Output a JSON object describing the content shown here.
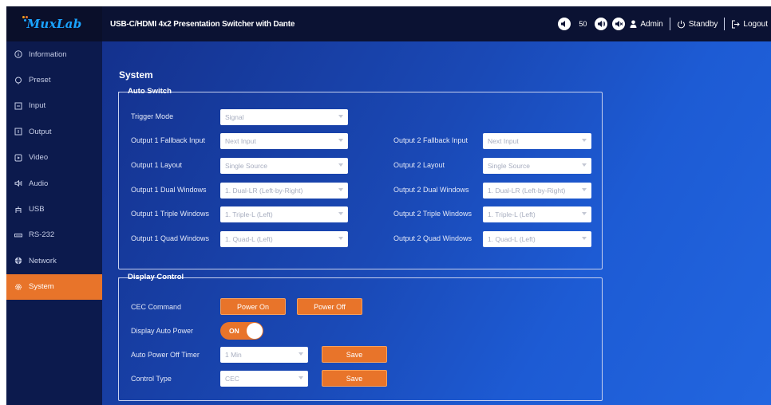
{
  "app": {
    "logo": "MuxLab",
    "title": "USB-C/HDMI 4x2 Presentation Switcher with Dante"
  },
  "topbar": {
    "volume_value": "50",
    "user_label": "Admin",
    "standby_label": "Standby",
    "logout_label": "Logout"
  },
  "sidebar": {
    "items": [
      {
        "label": "Information",
        "icon": "info-icon"
      },
      {
        "label": "Preset",
        "icon": "preset-icon"
      },
      {
        "label": "Input",
        "icon": "input-icon"
      },
      {
        "label": "Output",
        "icon": "output-icon"
      },
      {
        "label": "Video",
        "icon": "video-icon"
      },
      {
        "label": "Audio",
        "icon": "audio-icon"
      },
      {
        "label": "USB",
        "icon": "usb-icon"
      },
      {
        "label": "RS-232",
        "icon": "rs232-icon"
      },
      {
        "label": "Network",
        "icon": "network-icon"
      },
      {
        "label": "System",
        "icon": "gear-icon"
      }
    ],
    "active": "System"
  },
  "page": {
    "title": "System"
  },
  "auto_switch": {
    "legend": "Auto Switch",
    "trigger_mode": {
      "label": "Trigger Mode",
      "value": "Signal"
    },
    "out1": {
      "fallback": {
        "label": "Output 1 Fallback Input",
        "value": "Next Input"
      },
      "layout": {
        "label": "Output 1 Layout",
        "value": "Single Source"
      },
      "dual": {
        "label": "Output 1 Dual Windows",
        "value": "1. Dual-LR (Left-by-Right)"
      },
      "triple": {
        "label": "Output 1 Triple Windows",
        "value": "1. Triple-L (Left)"
      },
      "quad": {
        "label": "Output 1 Quad Windows",
        "value": "1. Quad-L (Left)"
      }
    },
    "out2": {
      "fallback": {
        "label": "Output 2 Fallback Input",
        "value": "Next Input"
      },
      "layout": {
        "label": "Output 2 Layout",
        "value": "Single Source"
      },
      "dual": {
        "label": "Output 2 Dual Windows",
        "value": "1. Dual-LR (Left-by-Right)"
      },
      "triple": {
        "label": "Output 2 Triple Windows",
        "value": "1. Triple-L (Left)"
      },
      "quad": {
        "label": "Output 2 Quad Windows",
        "value": "1. Quad-L (Left)"
      }
    }
  },
  "display_control": {
    "legend": "Display Control",
    "cec_command": {
      "label": "CEC Command",
      "power_on": "Power On",
      "power_off": "Power Off"
    },
    "auto_power": {
      "label": "Display Auto Power",
      "state": "ON"
    },
    "off_timer": {
      "label": "Auto Power Off Timer",
      "value": "1 Min",
      "save": "Save"
    },
    "control_type": {
      "label": "Control Type",
      "value": "CEC",
      "save": "Save"
    }
  },
  "colors": {
    "accent": "#e8742a",
    "sidebar_bg": "#0c1a4d",
    "topbar_bg": "#0b1233",
    "main_bg": "#1a49b6"
  }
}
